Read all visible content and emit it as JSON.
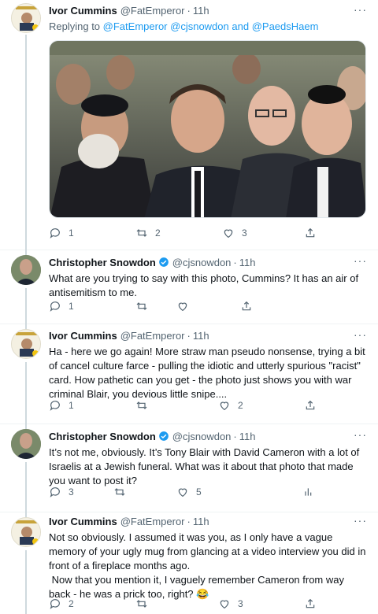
{
  "tweets": [
    {
      "name": "Ivor Cummins",
      "handle": "@FatEmperor",
      "dot": "·",
      "time": "11h",
      "reply_prefix": "Replying to",
      "reply_mentions": [
        "@FatEmperor",
        "@cjsnowdon",
        "and",
        "@PaedsHaem"
      ],
      "counts": {
        "reply": "1",
        "retweet": "2",
        "like": "3"
      }
    },
    {
      "name": "Christopher Snowdon",
      "handle": "@cjsnowdon",
      "dot": "·",
      "time": "11h",
      "text": "What are you trying to say with this photo, Cummins? It has an air of antisemitism to me.",
      "counts": {
        "reply": "1",
        "retweet": "",
        "like": ""
      }
    },
    {
      "name": "Ivor Cummins",
      "handle": "@FatEmperor",
      "dot": "·",
      "time": "11h",
      "text": "Ha - here we go again! More straw man pseudo nonsense, trying a bit of cancel culture farce - pulling the idiotic and utterly spurious \"racist\" card. How pathetic can you get - the photo just shows you with war criminal Blair, you devious little snipe....",
      "counts": {
        "reply": "1",
        "retweet": "",
        "like": "2"
      }
    },
    {
      "name": "Christopher Snowdon",
      "handle": "@cjsnowdon",
      "dot": "·",
      "time": "11h",
      "text": "It’s not me, obviously. It’s Tony Blair with David Cameron with a lot of Israelis at a Jewish funeral. What was it about that photo that made you want to post it?",
      "counts": {
        "reply": "3",
        "retweet": "",
        "like": "5"
      }
    },
    {
      "name": "Ivor Cummins",
      "handle": "@FatEmperor",
      "dot": "·",
      "time": "11h",
      "text": "Not so obviously. I assumed it was you, as I only have a vague memory of your ugly mug from glancing at a video interview you did in front of a fireplace months ago.\n Now that you mention it, I vaguely remember Cameron from way back - he was a prick too, right? 😂",
      "counts": {
        "reply": "2",
        "retweet": "",
        "like": "3"
      }
    }
  ],
  "more_label": "···",
  "colors": {
    "link": "#1d9bf0",
    "secondary": "#536471",
    "verified": "#1d9bf0"
  },
  "icons": [
    "reply-icon",
    "retweet-icon",
    "like-icon",
    "share-icon",
    "analytics-icon",
    "verified-badge-icon"
  ]
}
